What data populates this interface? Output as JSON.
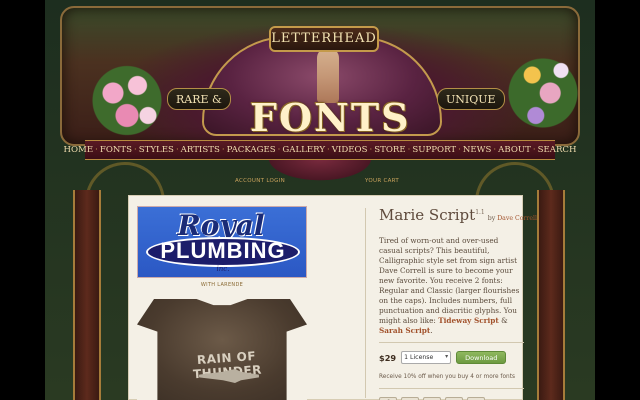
{
  "brand": {
    "title": "LETTERHEAD",
    "tagline_left": "RARE &",
    "tagline_right": "UNIQUE",
    "logo_word": "FONTS"
  },
  "nav": {
    "items": [
      "HOME",
      "FONTS",
      "STYLES",
      "ARTISTS",
      "PACKAGES",
      "GALLERY",
      "VIDEOS",
      "STORE",
      "SUPPORT",
      "NEWS",
      "ABOUT",
      "SEARCH"
    ],
    "separator": "·"
  },
  "sublinks": {
    "account": "ACCOUNT LOGIN",
    "cart": "YOUR CART"
  },
  "samples": {
    "royal_top": "Royal",
    "royal_main": "PLUMBING",
    "royal_inc": "inc.",
    "credit": "WITH LARENDE",
    "shirt_text": "RAIN OF THUNDER"
  },
  "product": {
    "title": "Marie Script",
    "version": "1.1",
    "by_label": "by",
    "artist": "Dave Correll",
    "desc_text": "Tired of worn-out and over-used casual scripts? This beautiful, Calligraphic style set from sign artist Dave Correll is sure to become your new favorite. You receive 2 fonts: Regular and Classic (larger flourishes on the caps). Includes numbers, full punctuation and diacritic glyphs. You might also like:",
    "also_like_1": "Tideway Script",
    "also_like_and": " & ",
    "also_like_2": "Sarah Script",
    "also_like_end": ".",
    "price": "$29",
    "license": "1 License",
    "download_label": "Download",
    "discount": "Receive 10% off when you buy 4 or more fonts"
  },
  "share": [
    {
      "icon": "facebook-icon",
      "glyph": "f"
    },
    {
      "icon": "pinterest-icon",
      "glyph": "P"
    },
    {
      "icon": "x-icon",
      "glyph": "X"
    },
    {
      "icon": "tumblr-icon",
      "glyph": "t"
    },
    {
      "icon": "link-icon",
      "glyph": "⚭"
    }
  ],
  "colors": {
    "nav_bg": "#4a1220",
    "accent_link": "#a2522c",
    "download_green": "#7aa84c"
  }
}
